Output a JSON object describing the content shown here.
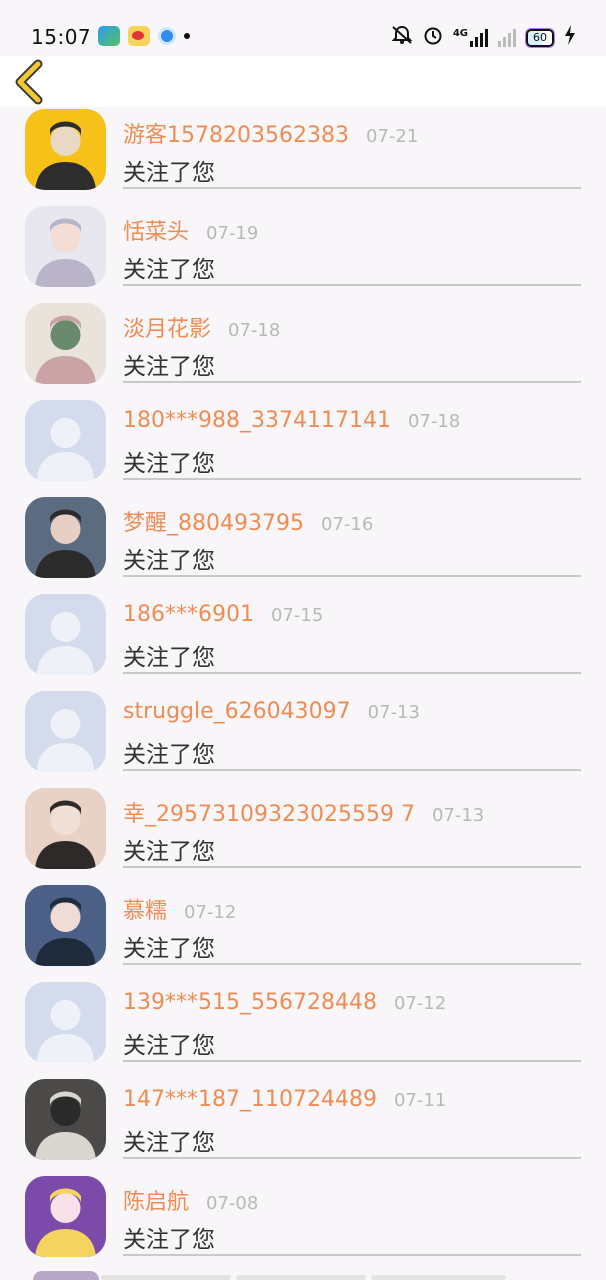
{
  "status_bar": {
    "time": "15:07",
    "network": "4G",
    "battery": "60"
  },
  "header": {
    "back_icon": "chevron-left-icon"
  },
  "items": [
    {
      "name": "游客1578203562383",
      "date": "07-21",
      "message": "关注了您",
      "avatar": "photo"
    },
    {
      "name": "恬菜头",
      "date": "07-19",
      "message": "关注了您",
      "avatar": "photo"
    },
    {
      "name": "淡月花影",
      "date": "07-18",
      "message": "关注了您",
      "avatar": "photo"
    },
    {
      "name": "180***988_3374117141",
      "date": "07-18",
      "message": "关注了您",
      "avatar": "default"
    },
    {
      "name": "梦醒_880493795",
      "date": "07-16",
      "message": "关注了您",
      "avatar": "photo"
    },
    {
      "name": "186***6901",
      "date": "07-15",
      "message": "关注了您",
      "avatar": "default"
    },
    {
      "name": "struggle_626043097",
      "date": "07-13",
      "message": "关注了您",
      "avatar": "default"
    },
    {
      "name": "幸_29573109323025559 7",
      "date": "07-13",
      "message": "关注了您",
      "avatar": "photo"
    },
    {
      "name": "慕糯",
      "date": "07-12",
      "message": "关注了您",
      "avatar": "photo"
    },
    {
      "name": "139***515_556728448",
      "date": "07-12",
      "message": "关注了您",
      "avatar": "default"
    },
    {
      "name": "147***187_110724489",
      "date": "07-11",
      "message": "关注了您",
      "avatar": "photo"
    },
    {
      "name": "陈启航",
      "date": "07-08",
      "message": "关注了您",
      "avatar": "photo"
    }
  ]
}
